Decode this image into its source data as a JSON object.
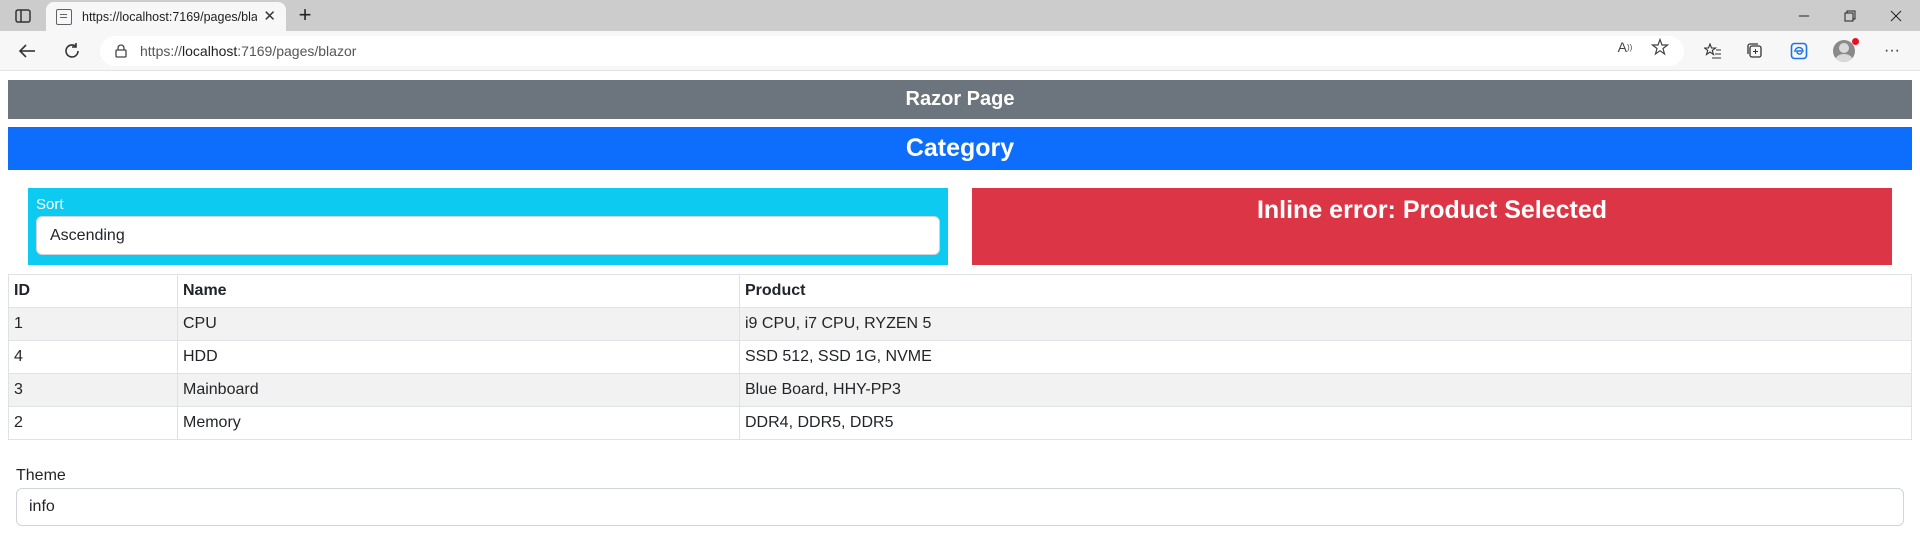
{
  "browser": {
    "tab_title": "https://localhost:7169/pages/blazor",
    "url_prefix": "https://",
    "url_host": "localhost",
    "url_rest": ":7169/pages/blazor"
  },
  "page": {
    "header_title": "Razor Page",
    "category_title": "Category",
    "sort": {
      "label": "Sort",
      "selected": "Ascending"
    },
    "error_message": "Inline error: Product Selected",
    "table": {
      "headers": [
        "ID",
        "Name",
        "Product"
      ],
      "rows": [
        {
          "id": "1",
          "name": "CPU",
          "product": "i9 CPU, i7 CPU, RYZEN 5"
        },
        {
          "id": "4",
          "name": "HDD",
          "product": "SSD 512, SSD 1G, NVME"
        },
        {
          "id": "3",
          "name": "Mainboard",
          "product": "Blue Board, HHY-PP3"
        },
        {
          "id": "2",
          "name": "Memory",
          "product": "DDR4, DDR5, DDR5"
        }
      ]
    },
    "theme": {
      "label": "Theme",
      "value": "info"
    }
  },
  "colors": {
    "header_bar": "#6c757d",
    "category_bar": "#0d6efd",
    "sort_box": "#0dcaf0",
    "error_box": "#dc3545"
  }
}
